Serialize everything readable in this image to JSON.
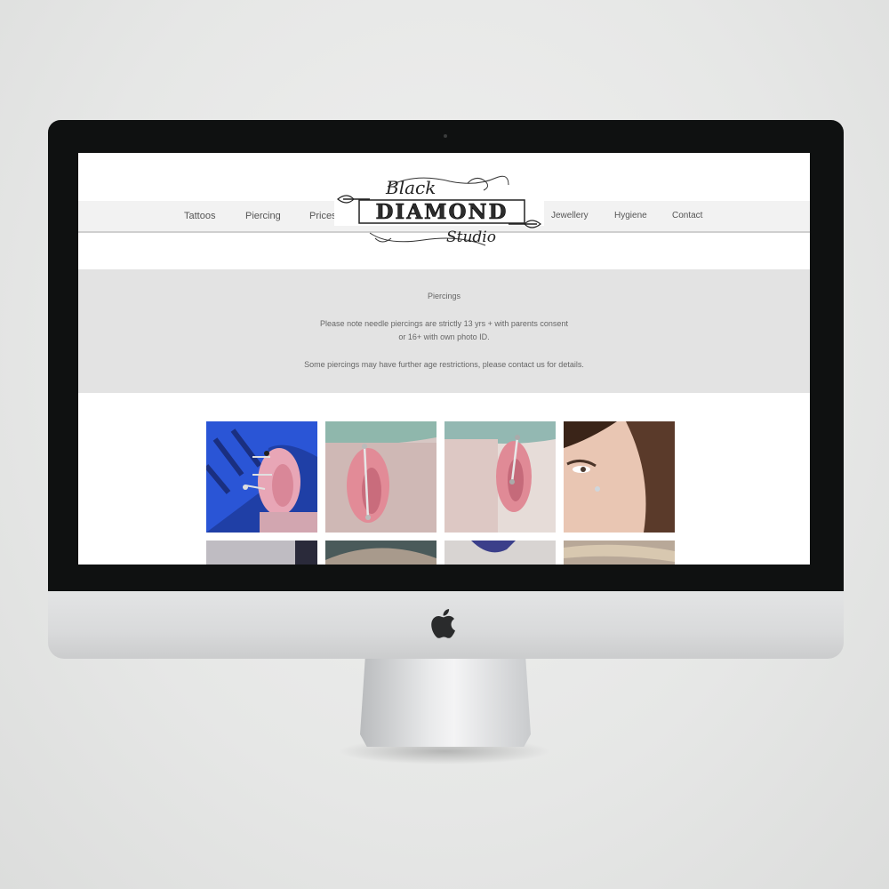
{
  "nav": {
    "items_left": [
      "Tattoos",
      "Piercing",
      "Prices"
    ],
    "items_right": [
      "Jewellery",
      "Hygiene",
      "Contact"
    ]
  },
  "logo": {
    "top_word": "Black",
    "main_word": "DIAMOND",
    "bottom_word": "Studio"
  },
  "notice": {
    "title": "Piercings",
    "line1": "Please note needle piercings are strictly 13 yrs + with parents consent",
    "line2": "or 16+ with own photo ID.",
    "line3": "Some piercings may have further age restrictions, please contact us for details."
  },
  "gallery": {
    "photos": [
      "ear-piercing-blue-hair",
      "industrial-piercing",
      "industrial-piercing-side",
      "cheek-dermal-piercing",
      "piercing-photo-5",
      "piercing-photo-6",
      "piercing-photo-7",
      "piercing-photo-8"
    ]
  },
  "colors": {
    "nav_band": "#f2f2f2",
    "notice_bg": "#e3e3e3",
    "bezel": "#0f1111"
  }
}
